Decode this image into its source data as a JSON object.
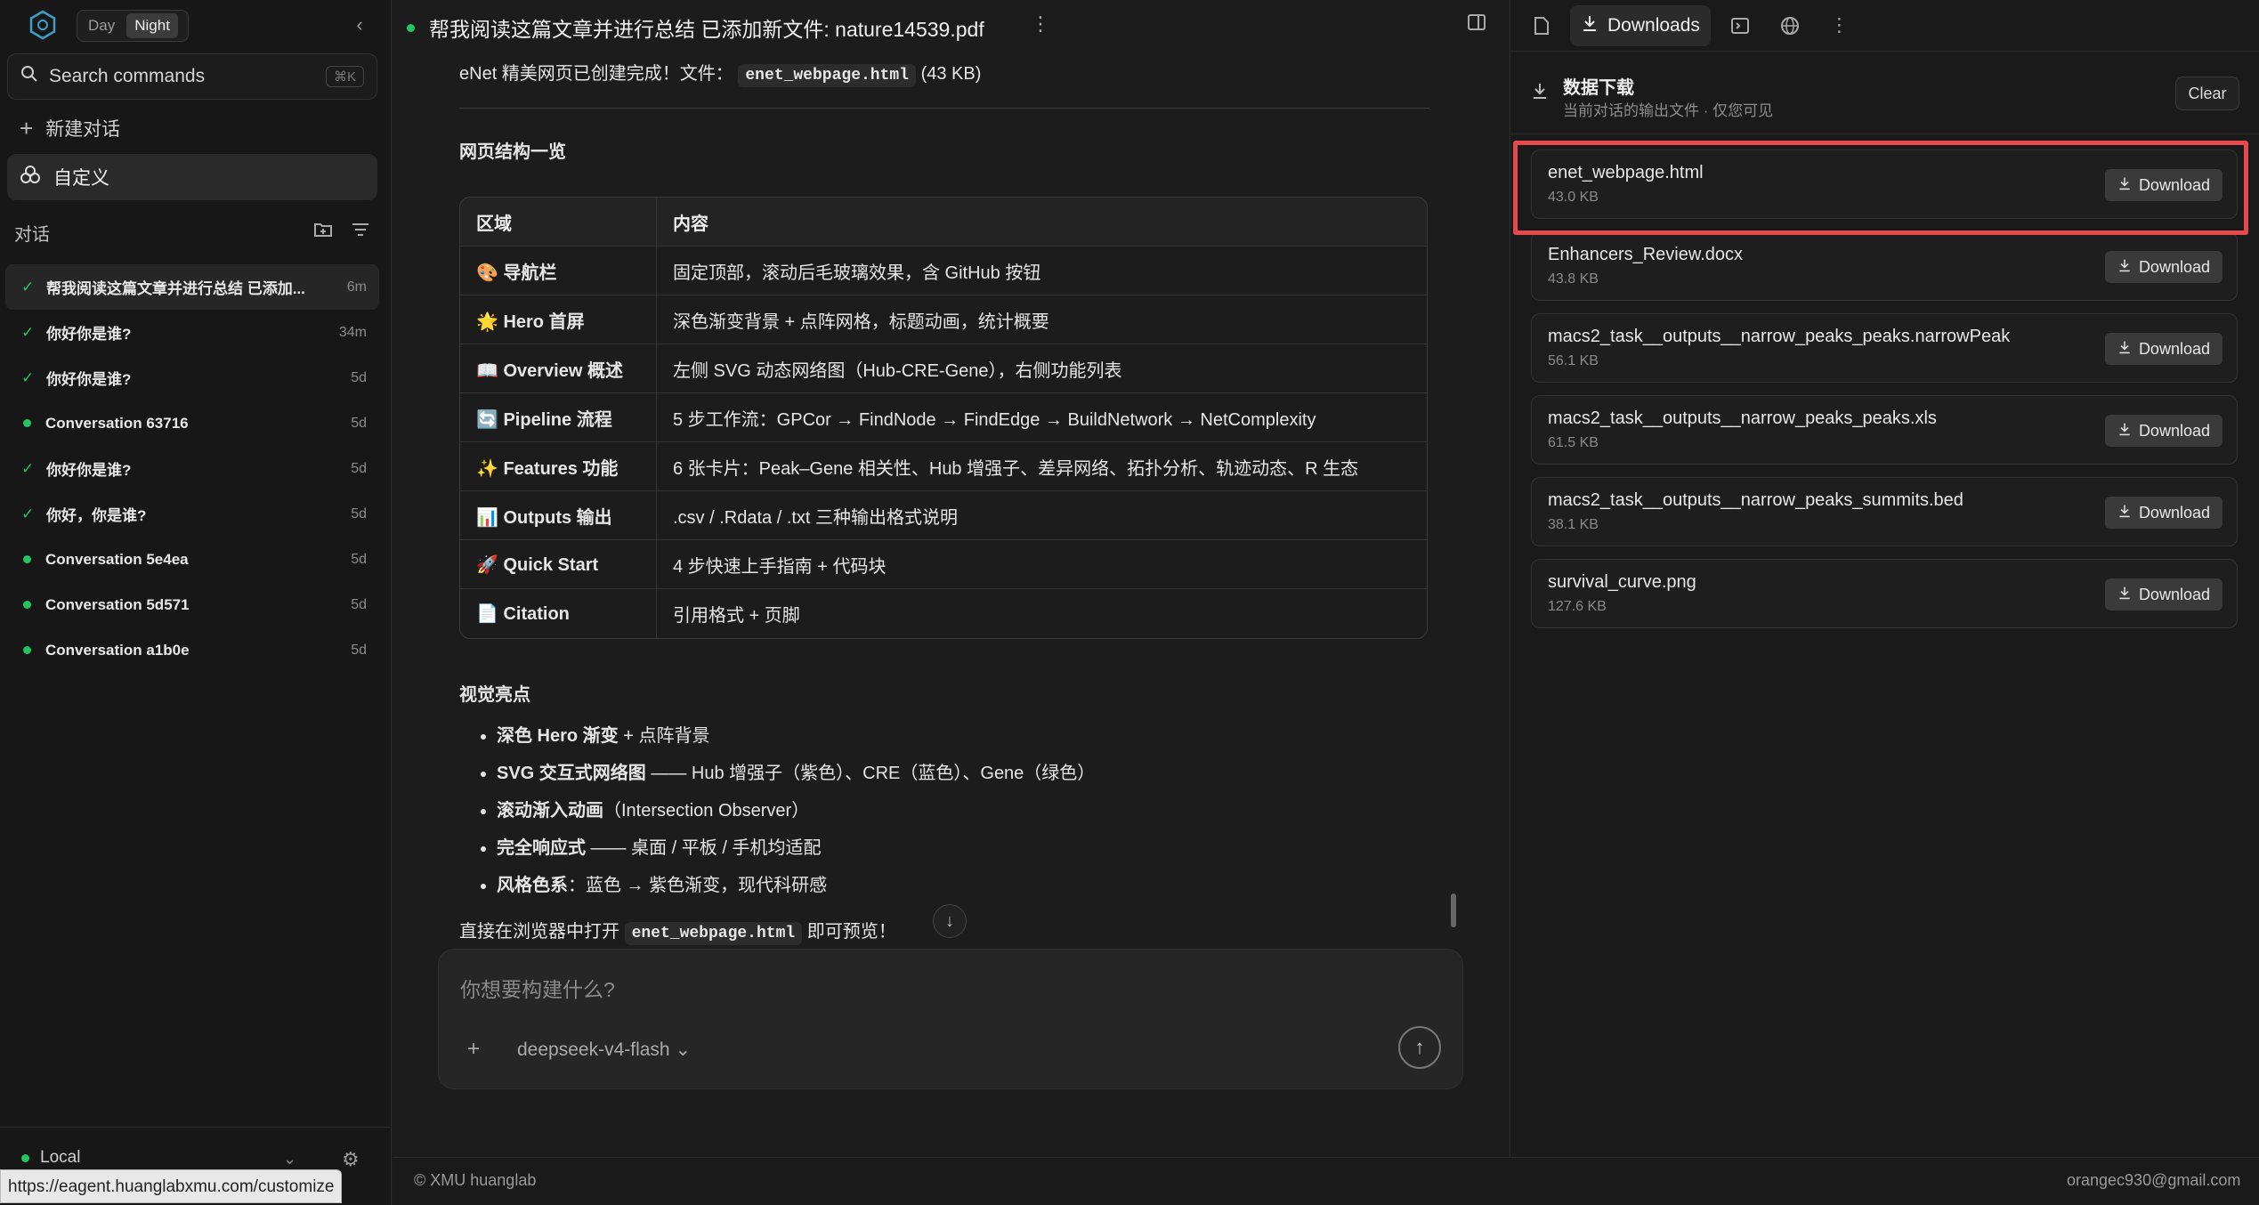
{
  "sidebar": {
    "theme": {
      "day": "Day",
      "night": "Night"
    },
    "search": {
      "label": "Search commands",
      "shortcut": "⌘K"
    },
    "new_chat": "新建对话",
    "custom": "自定义",
    "section_title": "对话",
    "conversations": [
      {
        "title": "帮我阅读这篇文章并进行总结 已添加...",
        "time": "6m",
        "status": "check",
        "active": true
      },
      {
        "title": "你好你是谁?",
        "time": "34m",
        "status": "check"
      },
      {
        "title": "你好你是谁?",
        "time": "5d",
        "status": "check"
      },
      {
        "title": "Conversation 63716",
        "time": "5d",
        "status": "dot"
      },
      {
        "title": "你好你是谁?",
        "time": "5d",
        "status": "check"
      },
      {
        "title": "你好，你是谁?",
        "time": "5d",
        "status": "check"
      },
      {
        "title": "Conversation 5e4ea",
        "time": "5d",
        "status": "dot"
      },
      {
        "title": "Conversation 5d571",
        "time": "5d",
        "status": "dot"
      },
      {
        "title": "Conversation a1b0e",
        "time": "5d",
        "status": "dot"
      }
    ],
    "env": "Local",
    "url_tooltip": "https://eagent.huanglabxmu.com/customize"
  },
  "chat": {
    "title": "帮我阅读这篇文章并进行总结 已添加新文件: nature14539.pdf",
    "intro_prefix": "eNet 精美网页已创建完成！文件：",
    "intro_file": "enet_webpage.html",
    "intro_suffix": " (43 KB)",
    "structure_heading": "网页结构一览",
    "table_headers": [
      "区域",
      "内容"
    ],
    "table_rows": [
      {
        "area": "🎨 导航栏",
        "content": "固定顶部，滚动后毛玻璃效果，含 GitHub 按钮"
      },
      {
        "area": "🌟 Hero 首屏",
        "content": "深色渐变背景 + 点阵网格，标题动画，统计概要"
      },
      {
        "area": "📖 Overview 概述",
        "content": "左侧 SVG 动态网络图（Hub-CRE-Gene），右侧功能列表"
      },
      {
        "area": "🔄 Pipeline 流程",
        "content": "5 步工作流：GPCor → FindNode → FindEdge → BuildNetwork → NetComplexity"
      },
      {
        "area": "✨ Features 功能",
        "content": "6 张卡片：Peak–Gene 相关性、Hub 增强子、差异网络、拓扑分析、轨迹动态、R 生态"
      },
      {
        "area": "📊 Outputs 输出",
        "content": ".csv / .Rdata / .txt 三种输出格式说明"
      },
      {
        "area": "🚀 Quick Start",
        "content": "4 步快速上手指南 + 代码块"
      },
      {
        "area": "📄 Citation",
        "content": "引用格式 + 页脚"
      }
    ],
    "visual_heading": "视觉亮点",
    "bullets": [
      {
        "bold": "深色 Hero 渐变",
        "rest": " + 点阵背景"
      },
      {
        "bold": "SVG 交互式网络图",
        "rest": " —— Hub 增强子（紫色）、CRE（蓝色）、Gene（绿色）"
      },
      {
        "bold": "滚动渐入动画",
        "rest": "（Intersection Observer）"
      },
      {
        "bold": "完全响应式",
        "rest": " —— 桌面 / 平板 / 手机均适配"
      },
      {
        "bold": "风格色系",
        "rest": "：蓝色 → 紫色渐变，现代科研感"
      }
    ],
    "final_prefix": "直接在浏览器中打开 ",
    "final_file": "enet_webpage.html",
    "final_suffix": " 即可预览！"
  },
  "composer": {
    "placeholder": "你想要构建什么?",
    "model": "deepseek-v4-flash"
  },
  "right_panel": {
    "active_tab": "Downloads",
    "downloads_title": "数据下载",
    "downloads_subtitle": "当前对话的输出文件 · 仅您可见",
    "clear_label": "Clear",
    "download_label": "Download",
    "files": [
      {
        "name": "enet_webpage.html",
        "size": "43.0 KB"
      },
      {
        "name": "Enhancers_Review.docx",
        "size": "43.8 KB"
      },
      {
        "name": "macs2_task__outputs__narrow_peaks_peaks.narrowPeak",
        "size": "56.1 KB"
      },
      {
        "name": "macs2_task__outputs__narrow_peaks_peaks.xls",
        "size": "61.5 KB"
      },
      {
        "name": "macs2_task__outputs__narrow_peaks_summits.bed",
        "size": "38.1 KB"
      },
      {
        "name": "survival_curve.png",
        "size": "127.6 KB"
      }
    ]
  },
  "footer": {
    "left": "© XMU huanglab",
    "right": "orangec930@gmail.com"
  },
  "colors": {
    "accent_green": "#22c55e",
    "highlight_red": "#e5484d"
  }
}
